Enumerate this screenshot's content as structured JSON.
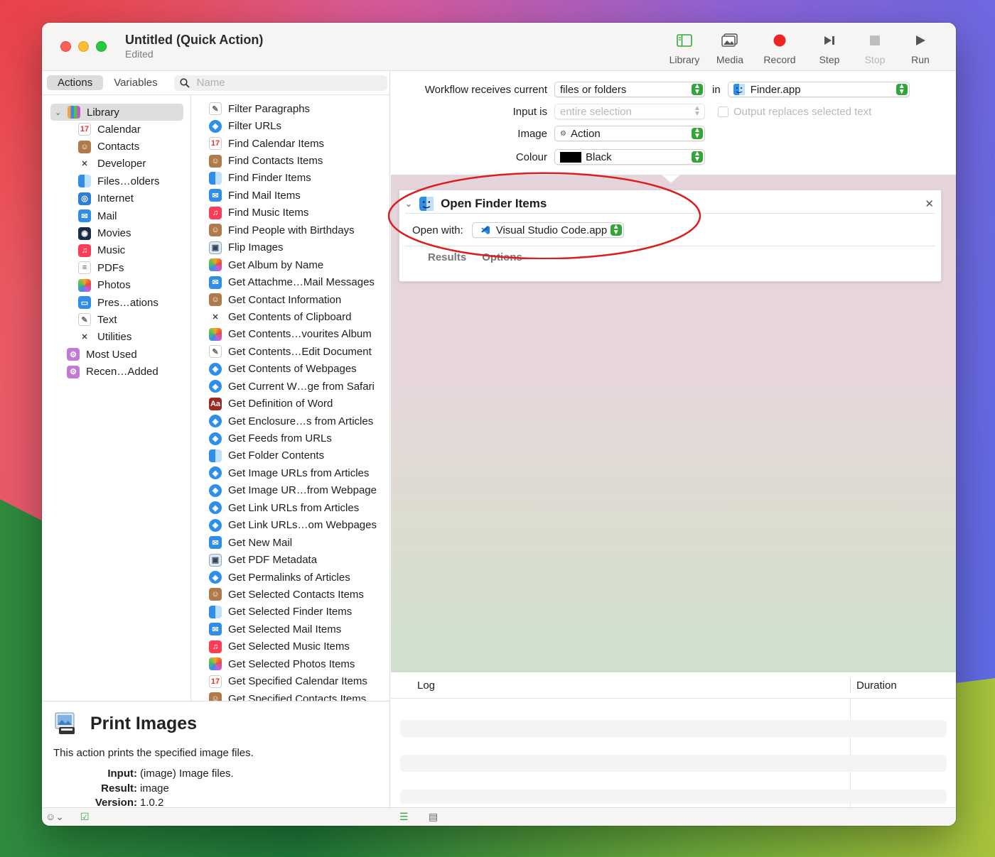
{
  "window": {
    "title": "Untitled (Quick Action)",
    "subtitle": "Edited"
  },
  "toolbar": {
    "library": "Library",
    "media": "Media",
    "record": "Record",
    "step": "Step",
    "stop": "Stop",
    "run": "Run"
  },
  "tabs": {
    "actions": "Actions",
    "variables": "Variables",
    "search_placeholder": "Name"
  },
  "categories": {
    "library": "Library",
    "items": [
      {
        "label": "Calendar",
        "icon": "calendar-icon"
      },
      {
        "label": "Contacts",
        "icon": "contacts-icon"
      },
      {
        "label": "Developer",
        "icon": "developer-icon"
      },
      {
        "label": "Files…olders",
        "icon": "finder-icon"
      },
      {
        "label": "Internet",
        "icon": "globe-icon"
      },
      {
        "label": "Mail",
        "icon": "mail-icon"
      },
      {
        "label": "Movies",
        "icon": "movies-icon"
      },
      {
        "label": "Music",
        "icon": "music-icon"
      },
      {
        "label": "PDFs",
        "icon": "pdf-icon"
      },
      {
        "label": "Photos",
        "icon": "photos-icon"
      },
      {
        "label": "Pres…ations",
        "icon": "presentations-icon"
      },
      {
        "label": "Text",
        "icon": "text-icon"
      },
      {
        "label": "Utilities",
        "icon": "utilities-icon"
      }
    ],
    "most_used": "Most Used",
    "recently_added": "Recen…Added"
  },
  "actions": [
    {
      "label": "Filter Paragraphs",
      "icon": "text-icon"
    },
    {
      "label": "Filter URLs",
      "icon": "safari-icon"
    },
    {
      "label": "Find Calendar Items",
      "icon": "calendar-icon"
    },
    {
      "label": "Find Contacts Items",
      "icon": "contacts-icon"
    },
    {
      "label": "Find Finder Items",
      "icon": "finder-icon"
    },
    {
      "label": "Find Mail Items",
      "icon": "mail-icon"
    },
    {
      "label": "Find Music Items",
      "icon": "music-icon"
    },
    {
      "label": "Find People with Birthdays",
      "icon": "contacts-icon"
    },
    {
      "label": "Flip Images",
      "icon": "preview-icon"
    },
    {
      "label": "Get Album by Name",
      "icon": "photos-icon"
    },
    {
      "label": "Get Attachme…Mail Messages",
      "icon": "mail-icon"
    },
    {
      "label": "Get Contact Information",
      "icon": "contacts-icon"
    },
    {
      "label": "Get Contents of Clipboard",
      "icon": "utilities-icon"
    },
    {
      "label": "Get Contents…vourites Album",
      "icon": "photos-icon"
    },
    {
      "label": "Get Contents…Edit Document",
      "icon": "text-icon"
    },
    {
      "label": "Get Contents of Webpages",
      "icon": "safari-icon"
    },
    {
      "label": "Get Current W…ge from Safari",
      "icon": "safari-icon"
    },
    {
      "label": "Get Definition of Word",
      "icon": "dictionary-icon"
    },
    {
      "label": "Get Enclosure…s from Articles",
      "icon": "safari-icon"
    },
    {
      "label": "Get Feeds from URLs",
      "icon": "safari-icon"
    },
    {
      "label": "Get Folder Contents",
      "icon": "finder-icon"
    },
    {
      "label": "Get Image URLs from Articles",
      "icon": "safari-icon"
    },
    {
      "label": "Get Image UR…from Webpage",
      "icon": "safari-icon"
    },
    {
      "label": "Get Link URLs from Articles",
      "icon": "safari-icon"
    },
    {
      "label": "Get Link URLs…om Webpages",
      "icon": "safari-icon"
    },
    {
      "label": "Get New Mail",
      "icon": "mail-icon"
    },
    {
      "label": "Get PDF Metadata",
      "icon": "preview-icon"
    },
    {
      "label": "Get Permalinks of Articles",
      "icon": "safari-icon"
    },
    {
      "label": "Get Selected Contacts Items",
      "icon": "contacts-icon"
    },
    {
      "label": "Get Selected Finder Items",
      "icon": "finder-icon"
    },
    {
      "label": "Get Selected Mail Items",
      "icon": "mail-icon"
    },
    {
      "label": "Get Selected Music Items",
      "icon": "music-icon"
    },
    {
      "label": "Get Selected Photos Items",
      "icon": "photos-icon"
    },
    {
      "label": "Get Specified Calendar Items",
      "icon": "calendar-icon"
    },
    {
      "label": "Get Specified Contacts Items",
      "icon": "contacts-icon"
    }
  ],
  "description": {
    "title": "Print Images",
    "text": "This action prints the specified image files.",
    "input_key": "Input:",
    "input_val": "(image) Image files.",
    "result_key": "Result:",
    "result_val": "image",
    "version_key": "Version:",
    "version_val": "1.0.2"
  },
  "workflow": {
    "receives_label": "Workflow receives current",
    "receives_value": "files or folders",
    "in_label": "in",
    "in_value": "Finder.app",
    "input_is_label": "Input is",
    "input_is_value": "entire selection",
    "output_replaces": "Output replaces selected text",
    "image_label": "Image",
    "image_value": "Action",
    "colour_label": "Colour",
    "colour_value": "Black",
    "colour_swatch": "#000000"
  },
  "action_box": {
    "title": "Open Finder Items",
    "open_with_label": "Open with:",
    "open_with_value": "Visual Studio Code.app",
    "tab_results": "Results",
    "tab_options": "Options",
    "highlight_color": "#d9201e"
  },
  "log": {
    "col_log": "Log",
    "col_duration": "Duration"
  },
  "colors": {
    "accent_green": "#35a53a",
    "record_red": "#ee2424"
  }
}
